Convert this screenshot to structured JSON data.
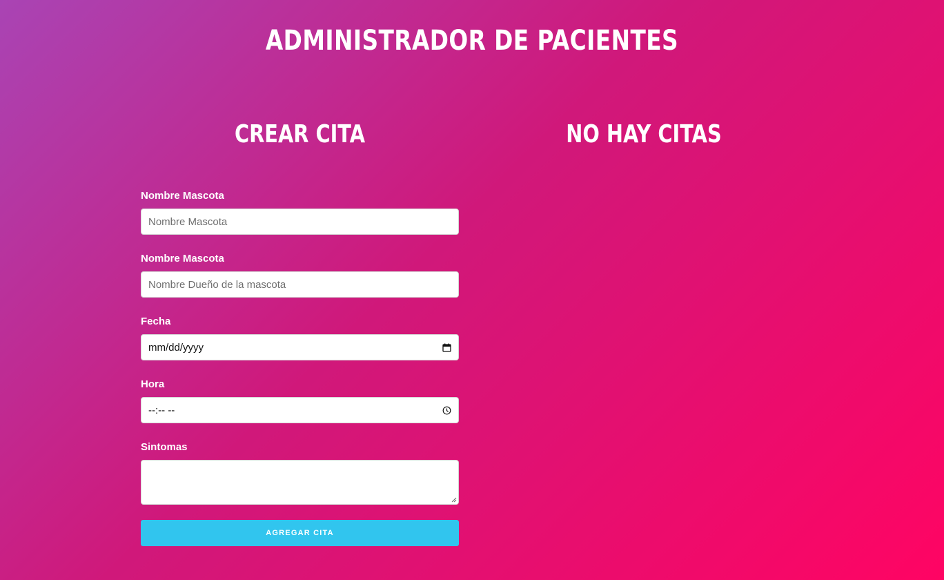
{
  "header": {
    "title": "ADMINISTRADOR DE PACIENTES"
  },
  "form_section": {
    "heading": "CREAR CITA",
    "fields": {
      "pet_name": {
        "label": "Nombre Mascota",
        "placeholder": "Nombre Mascota"
      },
      "owner_name": {
        "label": "Nombre Mascota",
        "placeholder": "Nombre Dueño de la mascota"
      },
      "date": {
        "label": "Fecha",
        "value": "mm/dd/yyyy",
        "icon": "calendar-icon"
      },
      "time": {
        "label": "Hora",
        "value": "--:-- --",
        "icon": "clock-icon"
      },
      "symptoms": {
        "label": "Sintomas",
        "value": ""
      }
    },
    "submit_label": "AGREGAR CITA"
  },
  "list_section": {
    "heading": "NO HAY CITAS"
  },
  "colors": {
    "gradient_start": "#a944b4",
    "gradient_end": "#ff0463",
    "button": "#31c5ee"
  }
}
